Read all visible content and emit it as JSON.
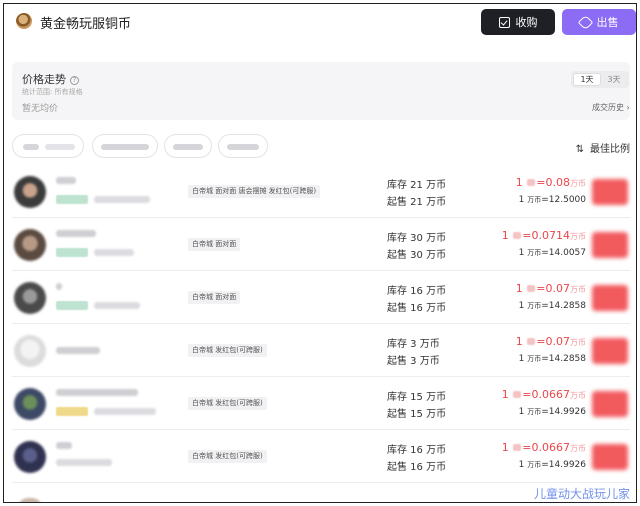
{
  "header": {
    "title": "黄金畅玩服铜币",
    "buy_label": "收购",
    "sell_label": "出售",
    "accent_sell": "#8c6cf5",
    "accent_buy": "#1f2026"
  },
  "trend": {
    "title": "价格走势",
    "subtitle": "统计范围: 所有规格",
    "no_avg": "暂无均价",
    "ranges": [
      "1天",
      "3天"
    ],
    "active_range": "1天",
    "history_label": "成交历史"
  },
  "filters": {
    "sort_label": "最佳比例"
  },
  "listings": [
    {
      "methods": "白帝城 面对面 唐会摆摊 发红包(可跨服)",
      "stock": "库存 21 万币",
      "min_sell": "起售 21 万币",
      "price_prefix": "1",
      "price_value": "=0.08",
      "price_unit": "万币",
      "rate_prefix": "1",
      "rate_unit": "万币",
      "rate_value": "=12.5000"
    },
    {
      "methods": "白帝城 面对面",
      "stock": "库存 30 万币",
      "min_sell": "起售 30 万币",
      "price_prefix": "1",
      "price_value": "=0.0714",
      "price_unit": "万币",
      "rate_prefix": "1",
      "rate_unit": "万币",
      "rate_value": "=14.0057"
    },
    {
      "methods": "白帝城 面对面",
      "stock": "库存 16 万币",
      "min_sell": "起售 16 万币",
      "price_prefix": "1",
      "price_value": "=0.07",
      "price_unit": "万币",
      "rate_prefix": "1",
      "rate_unit": "万币",
      "rate_value": "=14.2858"
    },
    {
      "methods": "白帝城 发红包(可跨服)",
      "stock": "库存 3 万币",
      "min_sell": "起售 3 万币",
      "price_prefix": "1",
      "price_value": "=0.07",
      "price_unit": "万币",
      "rate_prefix": "1",
      "rate_unit": "万币",
      "rate_value": "=14.2858"
    },
    {
      "methods": "白帝城 发红包(可跨服)",
      "stock": "库存 15 万币",
      "min_sell": "起售 15 万币",
      "price_prefix": "1",
      "price_value": "=0.0667",
      "price_unit": "万币",
      "rate_prefix": "1",
      "rate_unit": "万币",
      "rate_value": "=14.9926"
    },
    {
      "methods": "白帝城 发红包(可跨服)",
      "stock": "库存 16 万币",
      "min_sell": "起售 16 万币",
      "price_prefix": "1",
      "price_value": "=0.0667",
      "price_unit": "万币",
      "rate_prefix": "1",
      "rate_unit": "万币",
      "rate_value": "=14.9926"
    }
  ],
  "watermark": "儿童动大战玩儿家"
}
